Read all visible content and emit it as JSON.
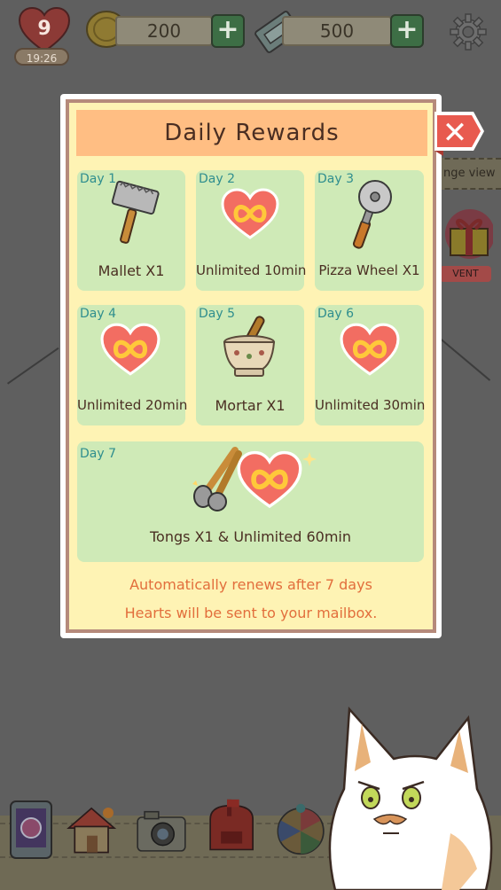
{
  "hud": {
    "hearts": "9",
    "timer": "19:26",
    "coins": "200",
    "tickets": "500",
    "add_coins_label": "+",
    "add_tickets_label": "+"
  },
  "background": {
    "side_tag": "nge view",
    "event_label": "VENT"
  },
  "dialog": {
    "title": "Daily Rewards",
    "close_label": "✕",
    "rewards": [
      {
        "day": "Day 1",
        "name": "Mallet X1",
        "icon": "mallet-icon"
      },
      {
        "day": "Day 2",
        "name": "Unlimited 10min",
        "icon": "infinity-heart-icon"
      },
      {
        "day": "Day 3",
        "name": "Pizza Wheel X1",
        "icon": "pizza-wheel-icon"
      },
      {
        "day": "Day 4",
        "name": "Unlimited 20min",
        "icon": "infinity-heart-icon"
      },
      {
        "day": "Day 5",
        "name": "Mortar X1",
        "icon": "mortar-icon"
      },
      {
        "day": "Day 6",
        "name": "Unlimited 30min",
        "icon": "infinity-heart-icon"
      },
      {
        "day": "Day 7",
        "name": "Tongs X1 & Unlimited 60min",
        "icon": "tongs-heart-icon"
      }
    ],
    "footer_line1": "Automatically renews after 7 days",
    "footer_line2": "Hearts will be sent to your mailbox."
  },
  "colors": {
    "title_bar": "#ffbe83",
    "card_green": "#cfeab7",
    "dialog_yellow": "#fef3b4",
    "close_red": "#e85a4f",
    "footer_text": "#e26e3c"
  }
}
